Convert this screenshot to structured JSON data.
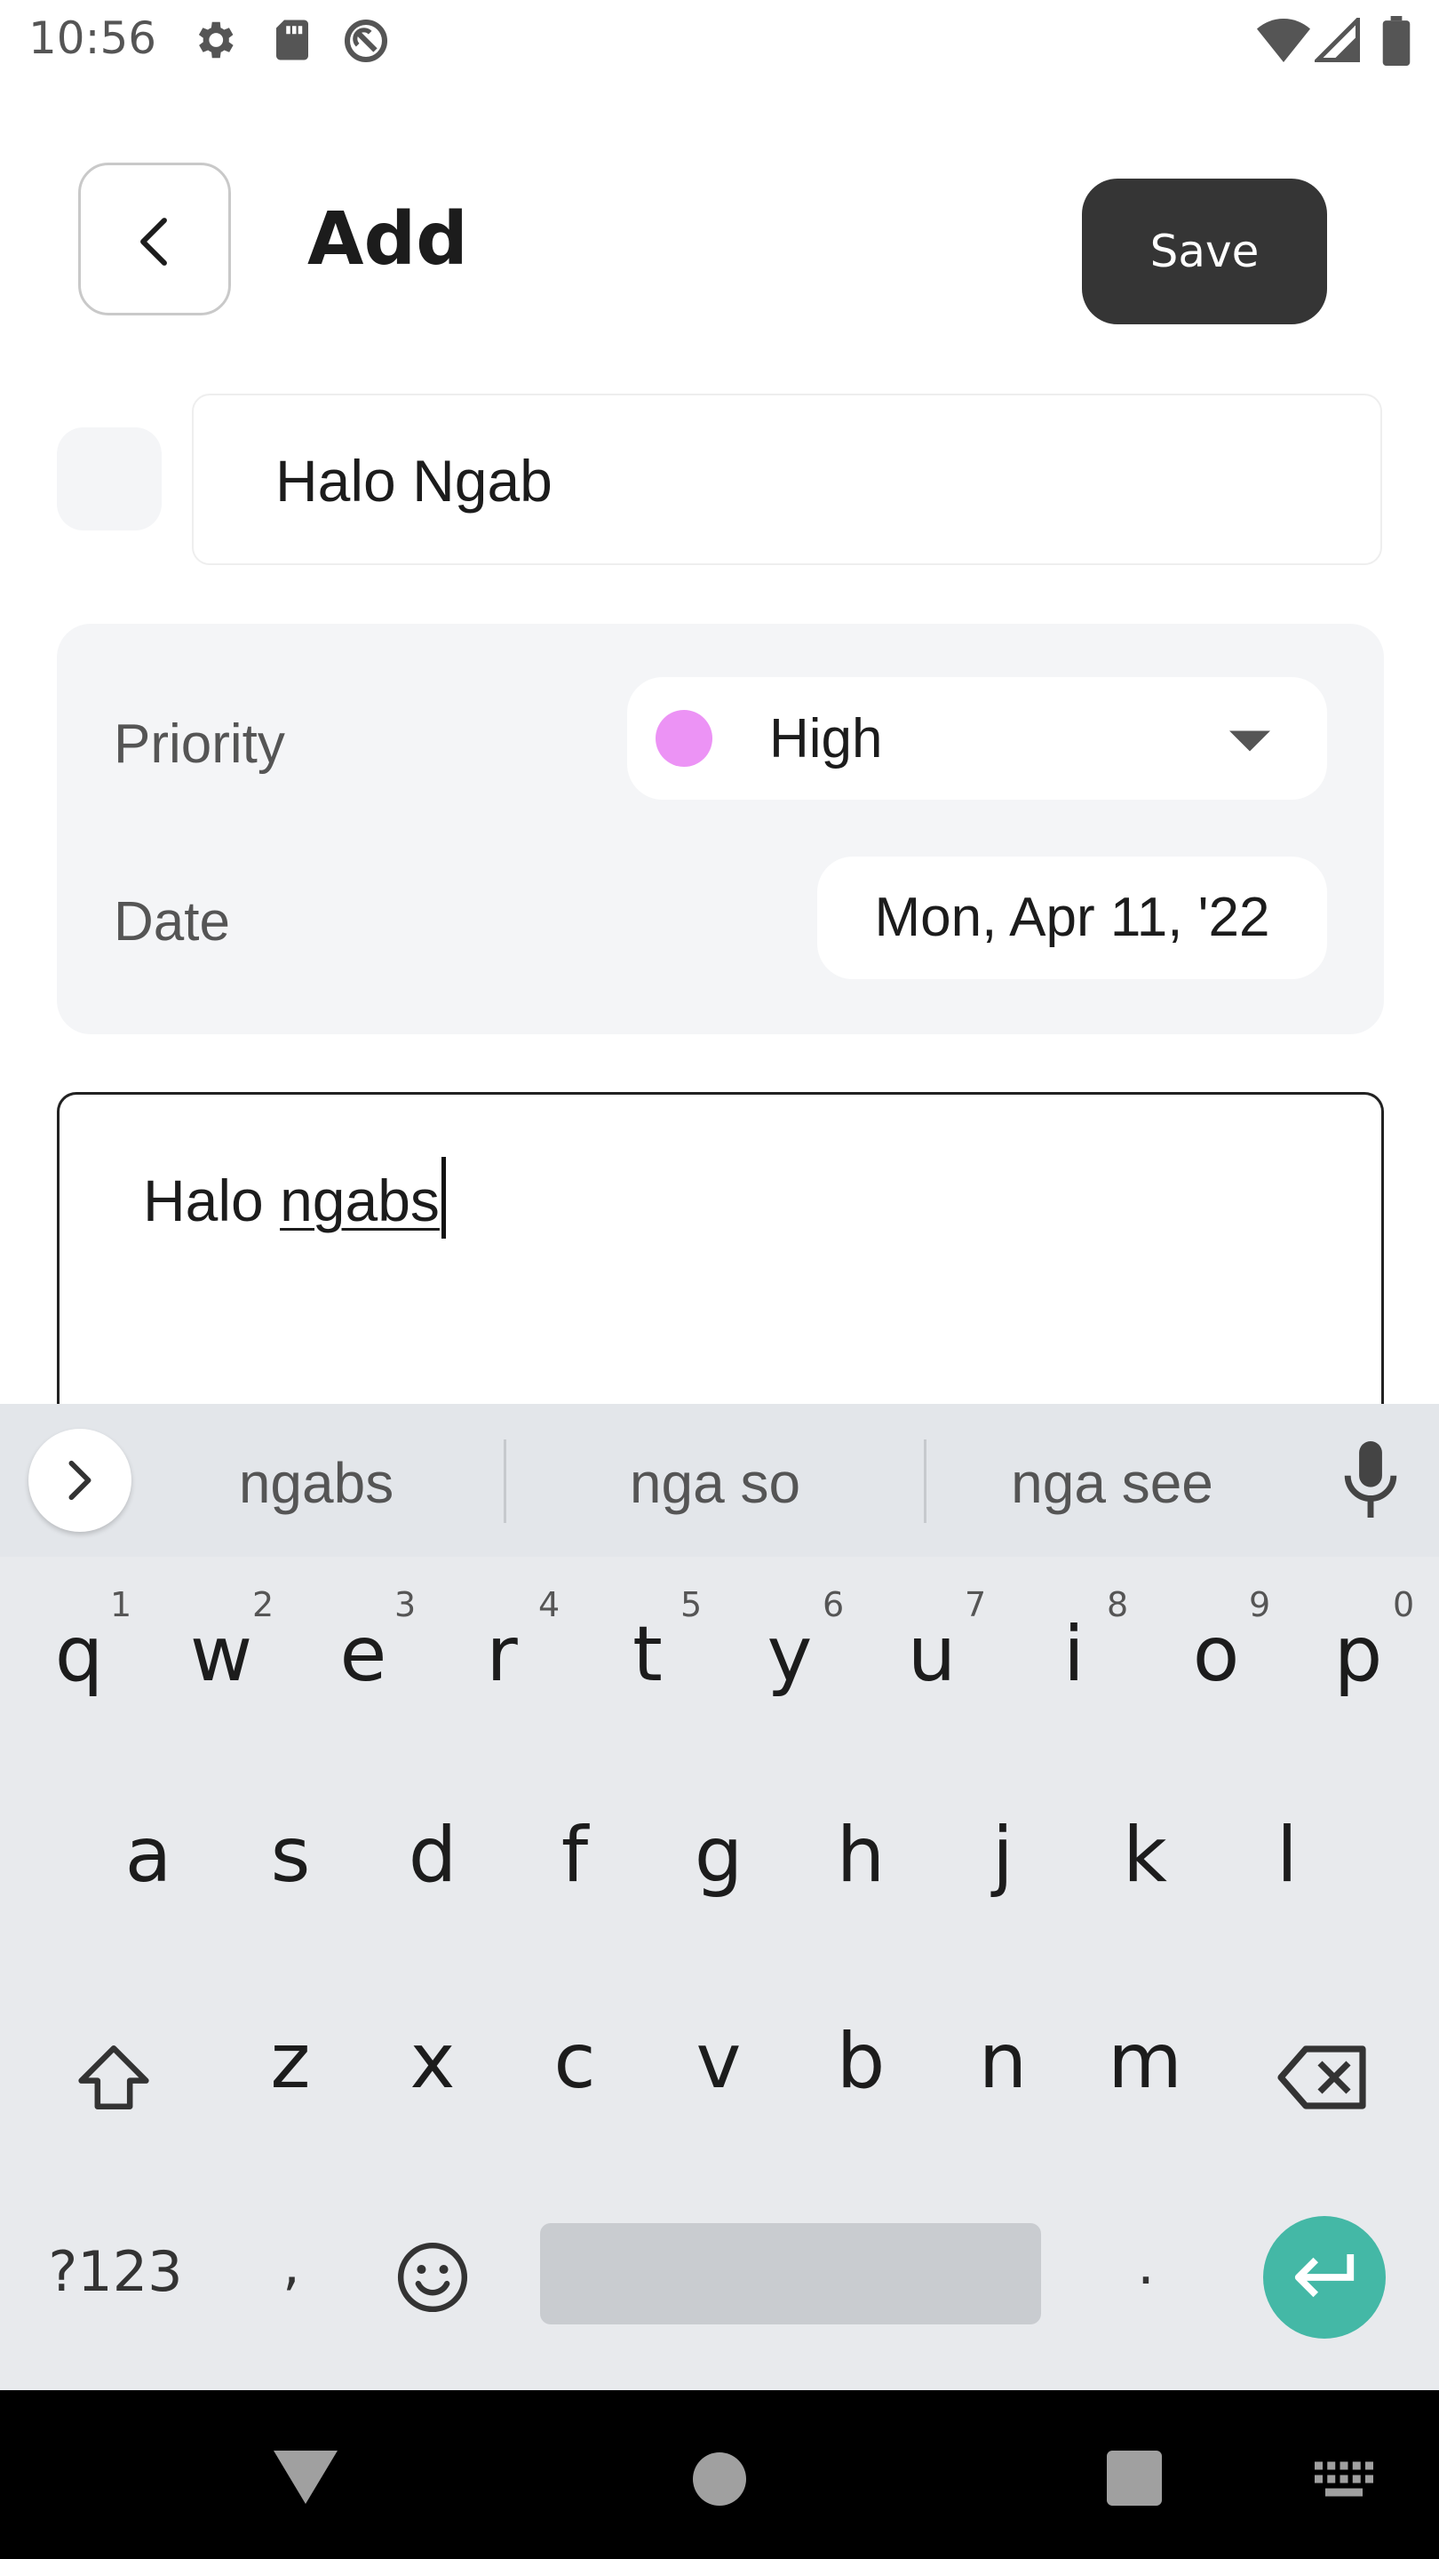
{
  "status_bar": {
    "time": "10:56",
    "icons": [
      "gear-icon",
      "sd-card-icon",
      "do-not-disturb-icon",
      "wifi-icon",
      "signal-icon",
      "battery-icon"
    ]
  },
  "header": {
    "title": "Add",
    "save_label": "Save",
    "back_icon": "chevron-left-icon"
  },
  "task": {
    "title_value": "Halo Ngab",
    "priority_label": "Priority",
    "priority_value": "High",
    "priority_color": "#ec93f5",
    "date_label": "Date",
    "date_value": "Mon, Apr 11, '22",
    "note_plain": "Halo ",
    "note_composing": "ngabs"
  },
  "keyboard": {
    "suggestions": [
      "ngabs",
      "nga so",
      "nga see"
    ],
    "row1": [
      "q",
      "w",
      "e",
      "r",
      "t",
      "y",
      "u",
      "i",
      "o",
      "p"
    ],
    "row1_numbers": [
      "1",
      "2",
      "3",
      "4",
      "5",
      "6",
      "7",
      "8",
      "9",
      "0"
    ],
    "row2": [
      "a",
      "s",
      "d",
      "f",
      "g",
      "h",
      "j",
      "k",
      "l"
    ],
    "row3": [
      "z",
      "x",
      "c",
      "v",
      "b",
      "n",
      "m"
    ],
    "symbols_label": "?123",
    "comma_label": ",",
    "period_label": ".",
    "accent_color": "#44b8a6"
  },
  "nav_bar": {
    "icons": [
      "back-triangle-icon",
      "home-circle-icon",
      "recents-square-icon",
      "keyboard-switch-icon"
    ]
  }
}
